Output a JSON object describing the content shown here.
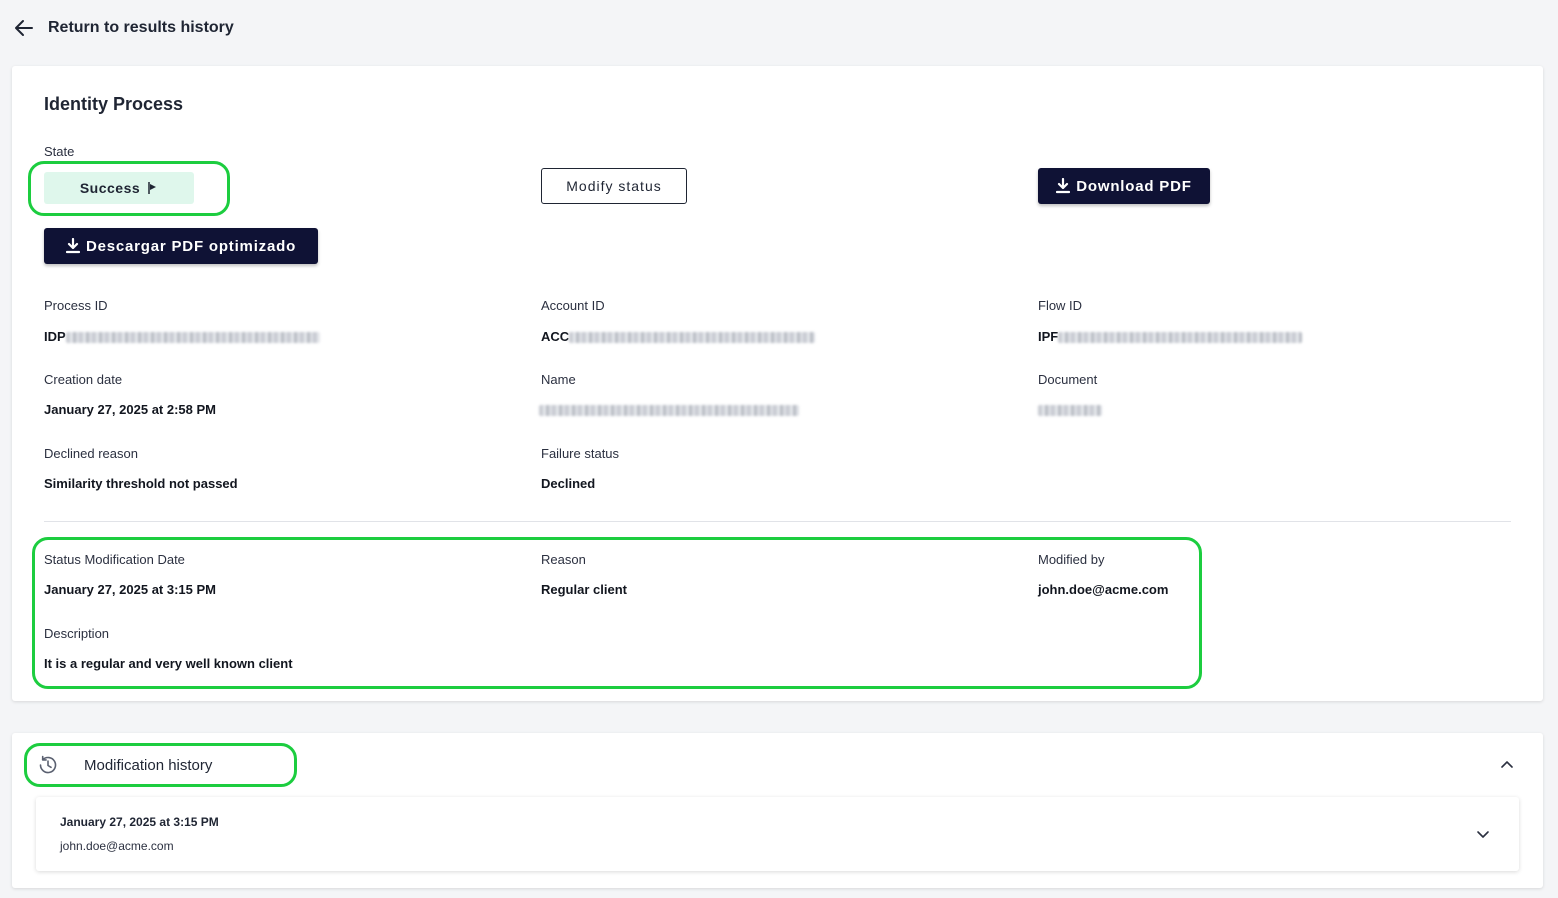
{
  "nav": {
    "back_label": "Return to results history"
  },
  "process": {
    "title": "Identity Process",
    "state_label": "State",
    "state_value": "Success",
    "modify_status_label": "Modify status",
    "download_pdf_label": "Download PDF",
    "download_optimized_label": "Descargar PDF optimizado",
    "fields": {
      "process_id": {
        "label": "Process ID",
        "prefix": "IDP"
      },
      "account_id": {
        "label": "Account ID",
        "prefix": "ACC"
      },
      "flow_id": {
        "label": "Flow ID",
        "prefix": "IPF"
      },
      "creation_date": {
        "label": "Creation date",
        "value": "January 27, 2025 at 2:58 PM"
      },
      "name": {
        "label": "Name"
      },
      "document": {
        "label": "Document"
      },
      "declined_reason": {
        "label": "Declined reason",
        "value": "Similarity threshold not passed"
      },
      "failure_status": {
        "label": "Failure status",
        "value": "Declined"
      }
    },
    "modification": {
      "date_label": "Status Modification Date",
      "date_value": "January 27, 2025 at 3:15 PM",
      "reason_label": "Reason",
      "reason_value": "Regular client",
      "modified_by_label": "Modified by",
      "modified_by_value": "john.doe@acme.com",
      "description_label": "Description",
      "description_value": "It is a regular and very well known client"
    }
  },
  "history": {
    "title": "Modification history",
    "items": [
      {
        "date": "January 27, 2025 at 3:15 PM",
        "user": "john.doe@acme.com"
      }
    ]
  },
  "colors": {
    "highlight": "#1ccd3f",
    "primary_button": "#0f1235",
    "success_badge": "#dff7ec"
  }
}
